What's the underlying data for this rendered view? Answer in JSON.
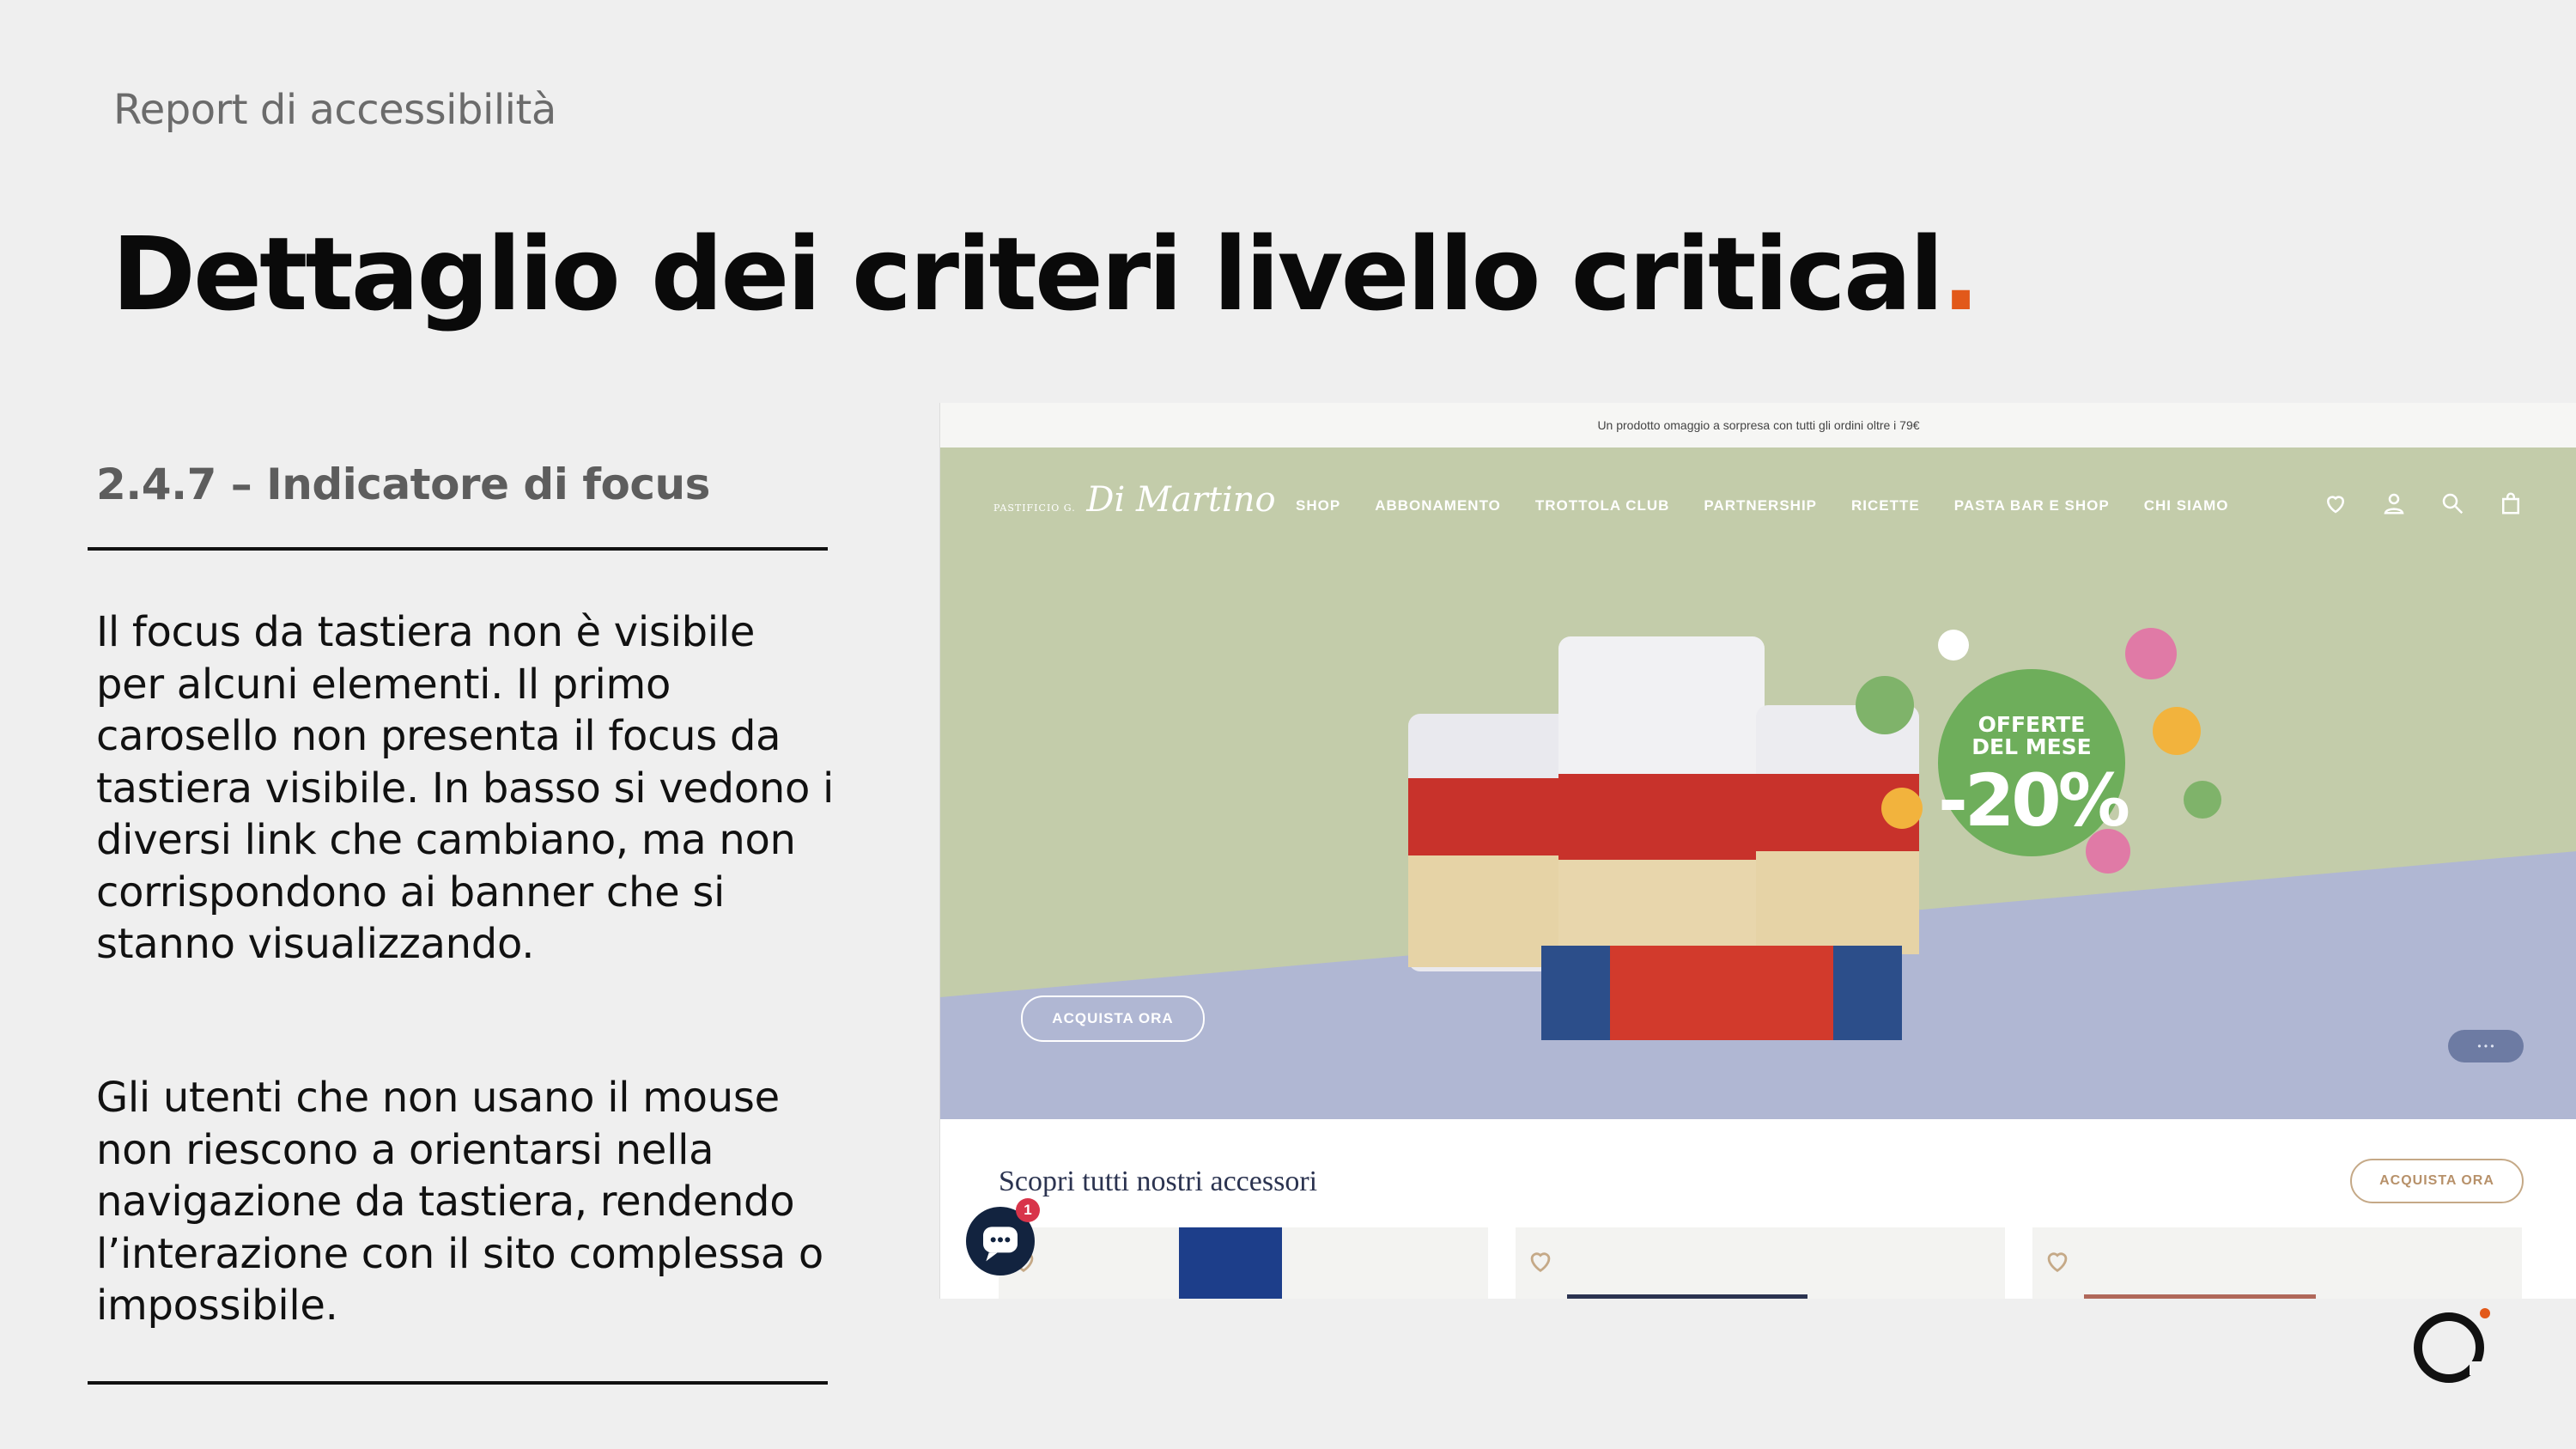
{
  "slide": {
    "subtitle": "Report di accessibilità",
    "title": "Dettaglio dei criteri livello critical",
    "title_dot": ".",
    "criterion": "2.4.7 – Indicatore di focus",
    "paragraph1": "Il focus da tastiera non è visibile per alcuni elementi. Il primo carosello non presenta il focus da tastiera visibile. In basso si vedono i diversi link che cambiano, ma non corrispondono ai banner che si stanno visualizzando.",
    "paragraph2": "Gli utenti che non usano il mouse non riescono a orientarsi nella navigazione da tastiera, rendendo l’interazione con il sito complessa o impossibile.",
    "accent_color": "#e2591a"
  },
  "screenshot": {
    "announcement": "Un prodotto omaggio a sorpresa con tutti gli ordini oltre i 79€",
    "logo_script": "Di Martino",
    "logo_small": "PASTIFICIO G.",
    "nav": [
      "SHOP",
      "ABBONAMENTO",
      "TROTTOLA CLUB",
      "PARTNERSHIP",
      "RICETTE",
      "PASTA BAR E SHOP",
      "CHI SIAMO"
    ],
    "icons": [
      "heart-icon",
      "user-icon",
      "search-icon",
      "bag-icon"
    ],
    "offer_line1": "OFFERTE",
    "offer_line2": "DEL MESE",
    "offer_value": "-20%",
    "hero_cta": "ACQUISTA ORA",
    "section_title": "Scopri tutti nostri accessori",
    "section_cta": "ACQUISTA ORA",
    "chat_badge": "1"
  }
}
